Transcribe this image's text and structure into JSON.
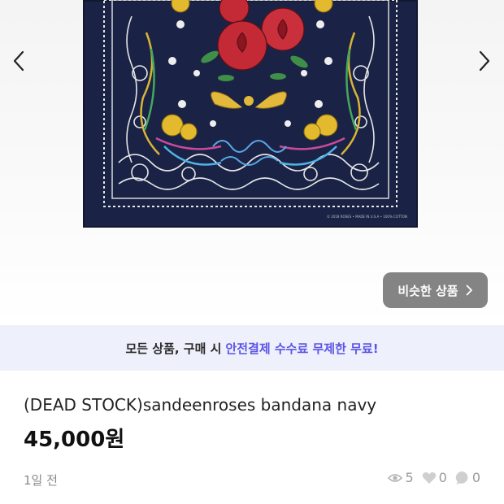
{
  "gallery": {
    "prev_icon": "chevron-left-icon",
    "next_icon": "chevron-right-icon",
    "image_fine_print": "© 2018 ROSES • MADE IN U.S.A • 100% COTTON",
    "similar_button": {
      "label": "비슷한 상품",
      "icon": "chevron-right-icon"
    }
  },
  "promo": {
    "prefix": "모든 상품, 구매 시",
    "highlight": "안전결제 수수료 무제한 무료!",
    "highlight_color": "#5b54e8",
    "background_color": "#eef0fb"
  },
  "product": {
    "title": "(DEAD STOCK)sandeenroses bandana navy",
    "price": "45,000원",
    "posted_time": "1일 전"
  },
  "stats": {
    "views": "5",
    "likes": "0",
    "chats": "0",
    "views_icon": "eye-icon",
    "likes_icon": "heart-icon",
    "chats_icon": "chat-bubble-icon"
  }
}
